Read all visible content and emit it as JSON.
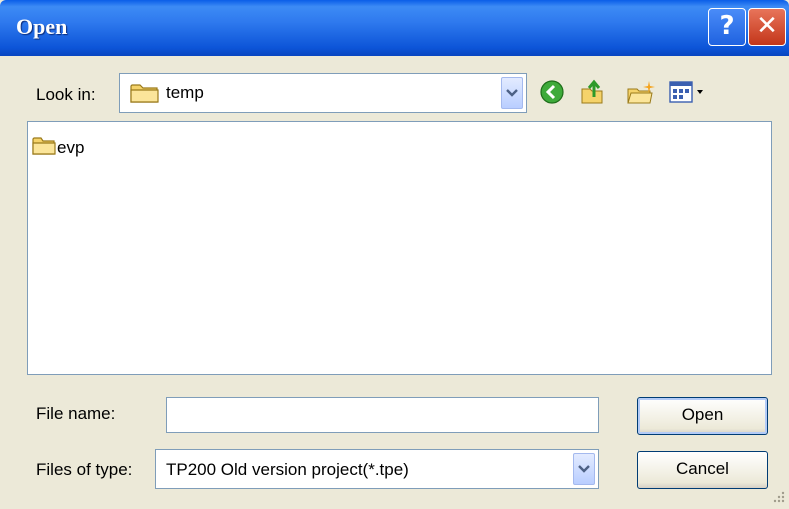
{
  "window": {
    "title": "Open",
    "help_glyph": "?",
    "close_glyph": "✕"
  },
  "look_in": {
    "label": "Look in:",
    "value": "temp",
    "icon": "folder-icon"
  },
  "toolbar": {
    "icons": [
      "back-icon",
      "up-folder-icon",
      "new-folder-icon",
      "view-menu-icon"
    ]
  },
  "file_list": {
    "items": [
      {
        "name": "evp",
        "icon": "folder-icon"
      }
    ]
  },
  "file_name": {
    "label": "File name:",
    "value": ""
  },
  "file_type": {
    "label": "Files of type:",
    "value": "TP200 Old version project(*.tpe)"
  },
  "buttons": {
    "open": "Open",
    "cancel": "Cancel"
  },
  "colors": {
    "titlebar": "#0a5ee8",
    "dialog_bg": "#ece9d8",
    "border": "#7f9db9",
    "close_red": "#c3361a"
  }
}
